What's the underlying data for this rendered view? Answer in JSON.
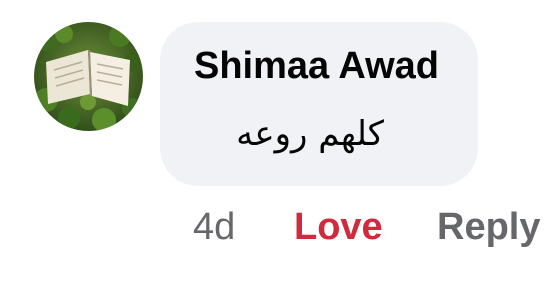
{
  "comment": {
    "author": "Shimaa Awad",
    "text": "كلهم روعه",
    "avatar_icon": "open-book-photo",
    "time": "4d",
    "love_label": "Love",
    "reply_label": "Reply"
  },
  "colors": {
    "bubble": "#f0f2f5",
    "love": "#d02a3c",
    "meta": "#65676b",
    "text": "#050505"
  }
}
